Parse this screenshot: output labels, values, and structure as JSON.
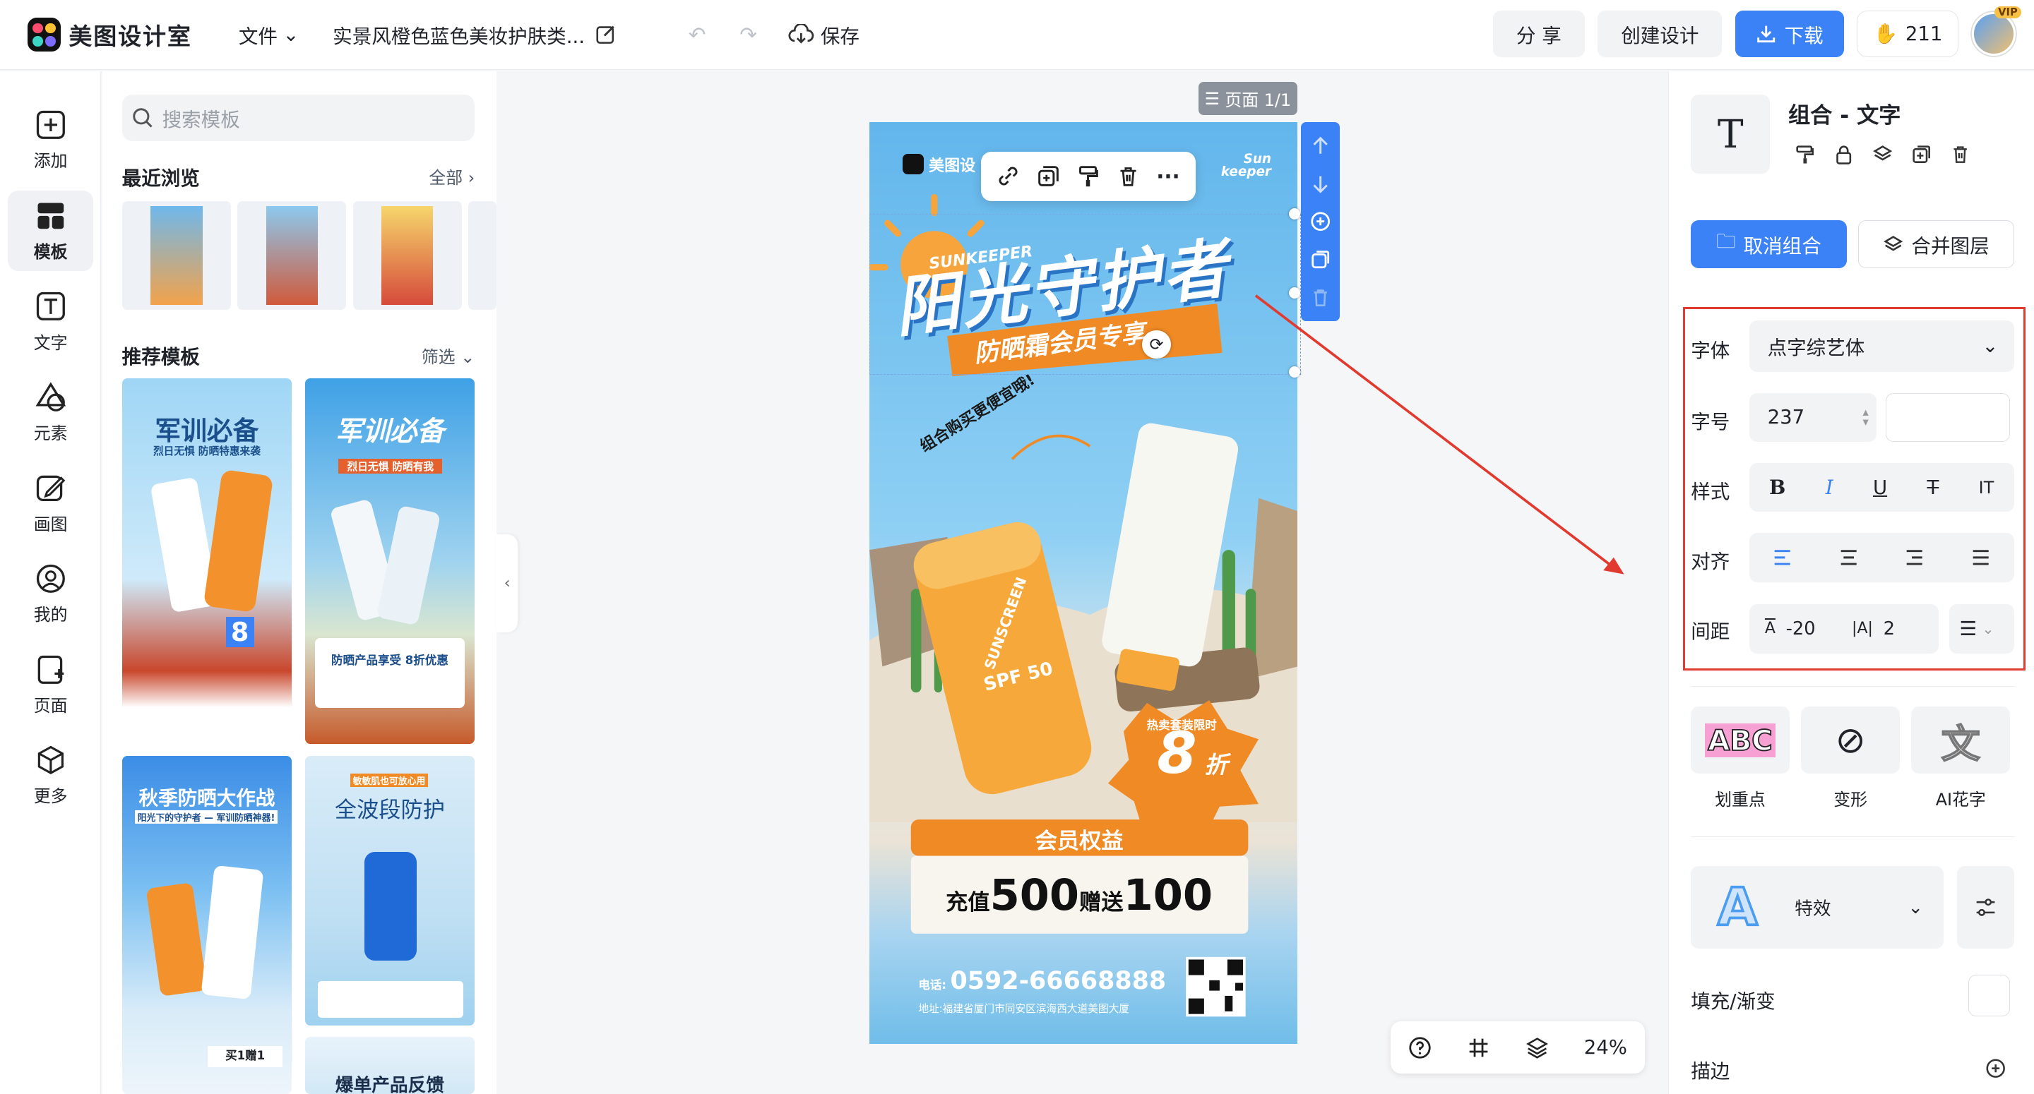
{
  "app": {
    "brand": "美图设计室",
    "file_menu": "文件",
    "doc_title": "实景风橙色蓝色美妆护肤类...",
    "save": "保存"
  },
  "top_actions": {
    "share": "分 享",
    "create": "创建设计",
    "download": "下载",
    "coins": "211",
    "vip": "VIP"
  },
  "leftnav": [
    {
      "label": "添加",
      "icon": "plus-square-icon"
    },
    {
      "label": "模板",
      "icon": "template-grid-icon"
    },
    {
      "label": "文字",
      "icon": "text-t-icon"
    },
    {
      "label": "元素",
      "icon": "shapes-icon"
    },
    {
      "label": "画图",
      "icon": "pencil-icon"
    },
    {
      "label": "我的",
      "icon": "user-icon"
    },
    {
      "label": "页面",
      "icon": "page-add-icon"
    },
    {
      "label": "更多",
      "icon": "cube-icon"
    }
  ],
  "templates": {
    "search_placeholder": "搜索模板",
    "recent_title": "最近浏览",
    "recent_all": "全部",
    "recommend_title": "推荐模板",
    "filter": "筛选",
    "cards": [
      {
        "title": "军训必备",
        "sub": "烈日无惧 防晒特惠来袭",
        "price": "8"
      },
      {
        "title": "军训必备",
        "sub": "烈日无惧 防晒有我",
        "offer": "防晒产品享受 8折优惠"
      },
      {
        "title": "秋季防晒大作战",
        "sub": "阳光下的守护者 — 军训防晒神器!",
        "tag": "买1赠1"
      },
      {
        "title": "全波段防护",
        "sub": "敏敏肌也可放心用"
      },
      {
        "title": "爆单产品反馈"
      }
    ]
  },
  "canvas": {
    "page_tag": "页面 1/1",
    "brand_small": "美图设",
    "sunkeeper": "Sun keeper",
    "headline": "阳光守护者",
    "headline_en": "SUNKEEPER",
    "subhead": "防晒霜会员专享",
    "diagonal": "组合购买更便宜哦!",
    "product1": "SUNSCREEN",
    "spf": "SPF 50",
    "sale_small": "热卖套装限时",
    "sale_big": "8",
    "sale_unit": "折",
    "member": "会员权益",
    "recharge_a": "充值",
    "recharge_b": "500",
    "recharge_c": "赠送",
    "recharge_d": "100",
    "phone_label": "电话:",
    "phone": "0592-66668888",
    "addr": "地址:福建省厦门市同安区滨海西大道美图大厦"
  },
  "bottom": {
    "zoom": "24%"
  },
  "props": {
    "title": "组合 - 文字",
    "ungroup": "取消组合",
    "merge": "合并图层",
    "font_label": "字体",
    "font_value": "点字综艺体",
    "size_label": "字号",
    "size_value": "237",
    "style_label": "样式",
    "style_buttons": [
      "B",
      "I",
      "U",
      "T",
      "IT"
    ],
    "align_label": "对齐",
    "spacing_label": "间距",
    "letter_spacing": "-20",
    "line_spacing": "2",
    "effects": [
      {
        "label": "划重点",
        "glyph": "ABC"
      },
      {
        "label": "变形",
        "glyph": "⊘"
      },
      {
        "label": "AI花字",
        "glyph": "文"
      }
    ],
    "fx_label": "特效",
    "fill_label": "填充/渐变",
    "stroke_label": "描边"
  },
  "colors": {
    "accent": "#3b82f6",
    "annotation": "#e13b2f",
    "canvas_top": "#62b6ec",
    "orange": "#f08a24"
  }
}
